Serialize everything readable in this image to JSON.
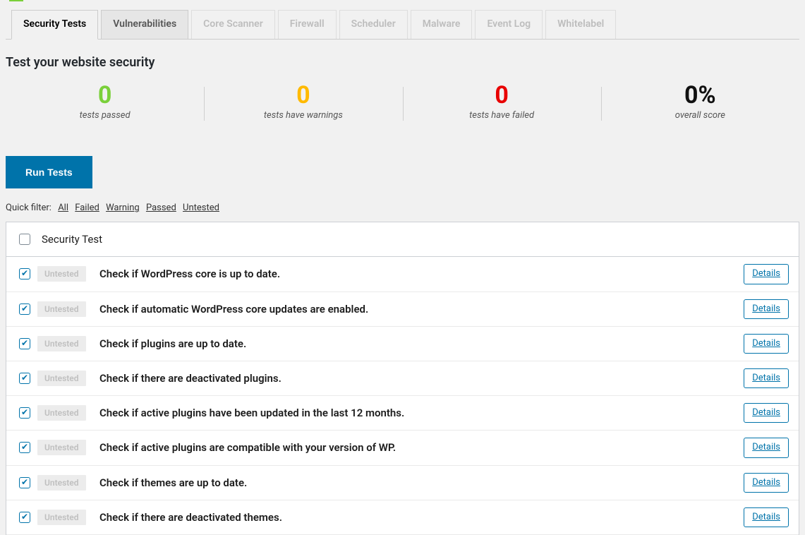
{
  "tabs": [
    {
      "label": "Security Tests",
      "state": "active"
    },
    {
      "label": "Vulnerabilities",
      "state": "normal"
    },
    {
      "label": "Core Scanner",
      "state": "disabled"
    },
    {
      "label": "Firewall",
      "state": "disabled"
    },
    {
      "label": "Scheduler",
      "state": "disabled"
    },
    {
      "label": "Malware",
      "state": "disabled"
    },
    {
      "label": "Event Log",
      "state": "disabled"
    },
    {
      "label": "Whitelabel",
      "state": "disabled"
    }
  ],
  "heading": "Test your website security",
  "stats": {
    "passed": {
      "value": "0",
      "label": "tests passed"
    },
    "warning": {
      "value": "0",
      "label": "tests have warnings"
    },
    "failed": {
      "value": "0",
      "label": "tests have failed"
    },
    "score": {
      "value": "0%",
      "label": "overall score"
    }
  },
  "run_button": "Run Tests",
  "filter": {
    "label": "Quick filter:",
    "all": "All",
    "failed": "Failed",
    "warning": "Warning",
    "passed": "Passed",
    "untested": "Untested"
  },
  "table": {
    "header": "Security Test",
    "status_label": "Untested",
    "details_label": "Details",
    "rows": [
      {
        "title": "Check if WordPress core is up to date."
      },
      {
        "title": "Check if automatic WordPress core updates are enabled."
      },
      {
        "title": "Check if plugins are up to date."
      },
      {
        "title": "Check if there are deactivated plugins."
      },
      {
        "title": "Check if active plugins have been updated in the last 12 months."
      },
      {
        "title": "Check if active plugins are compatible with your version of WP."
      },
      {
        "title": "Check if themes are up to date."
      },
      {
        "title": "Check if there are deactivated themes."
      }
    ]
  }
}
